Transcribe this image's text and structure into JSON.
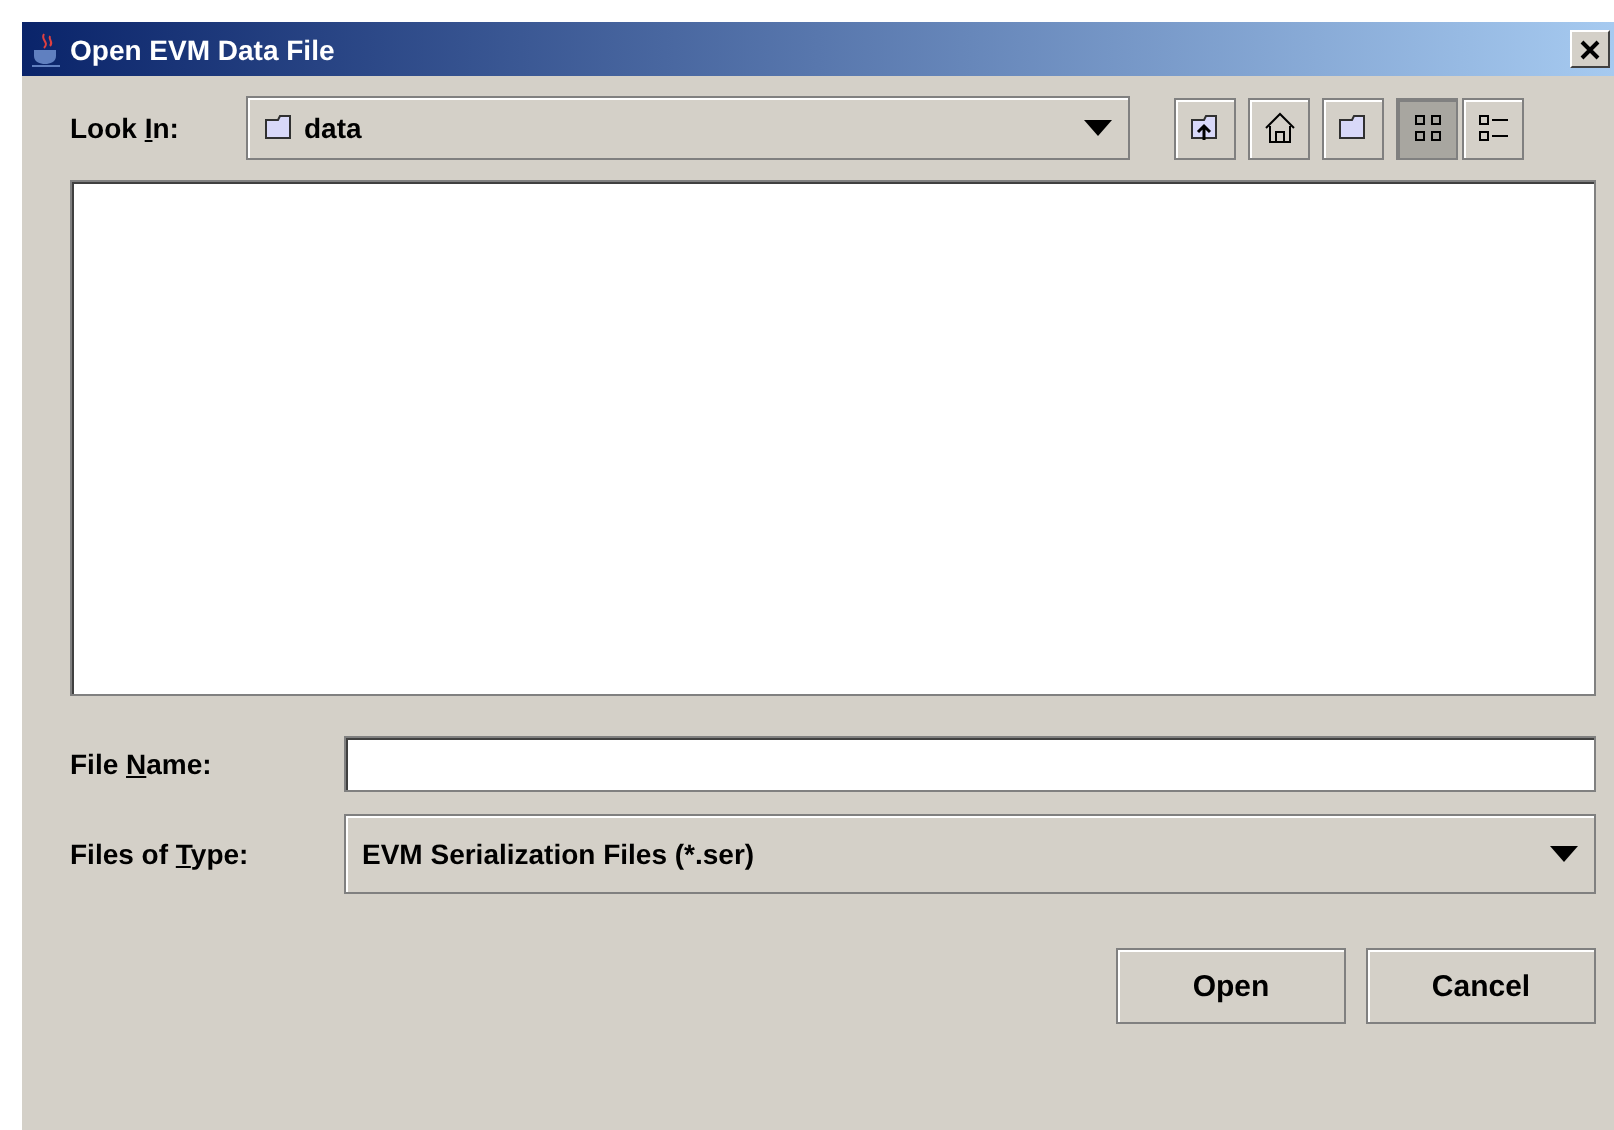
{
  "window": {
    "title": "Open EVM Data File"
  },
  "look_in": {
    "label": {
      "before": "Look ",
      "key": "I",
      "after": "n:"
    },
    "value": "data"
  },
  "toolbar": {
    "view_buttons": [
      {
        "kind": "icons",
        "selected": true
      },
      {
        "kind": "details",
        "selected": false
      }
    ]
  },
  "file_name": {
    "label": {
      "before": "File ",
      "key": "N",
      "after": "ame:"
    }
  },
  "files_of_type": {
    "label": {
      "before": "Files of ",
      "key": "T",
      "after": "ype:"
    },
    "value": "EVM Serialization Files (*.ser)"
  },
  "buttons": [
    "Open",
    "Cancel"
  ]
}
